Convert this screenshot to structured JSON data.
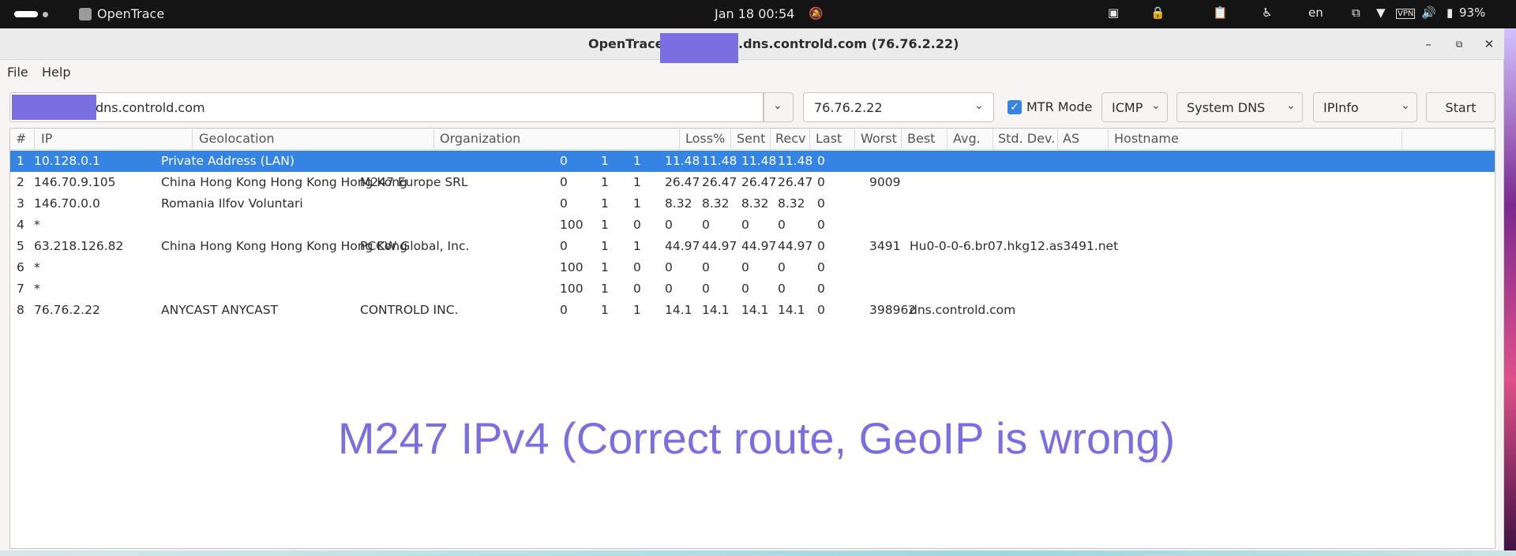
{
  "topbar": {
    "app_name": "OpenTrace",
    "datetime": "Jan 18  00:54",
    "lang": "en",
    "vpn": "VPN",
    "battery": "93%"
  },
  "window": {
    "title_prefix": "OpenTrace: ",
    "title_suffix": ".dns.controld.com (76.76.2.22)"
  },
  "menu": [
    "File",
    "Help"
  ],
  "toolbar": {
    "host_value": "dns.controld.com",
    "resolved_ip": "76.76.2.22",
    "mtr_mode_label": "MTR Mode",
    "mtr_mode_checked": true,
    "protocol": "ICMP",
    "dns": "System DNS",
    "geo_provider": "IPInfo",
    "start_label": "Start"
  },
  "table": {
    "headers": [
      "#",
      "IP",
      "Geolocation",
      "Organization",
      "Loss%",
      "Sent",
      "Recv",
      "Last",
      "Worst",
      "Best",
      "Avg.",
      "Std. Dev.",
      "AS",
      "Hostname"
    ],
    "rows": [
      [
        "1",
        "10.128.0.1",
        "Private Address (LAN)",
        "",
        "0",
        "1",
        "1",
        "11.48",
        "11.48",
        "11.48",
        "11.48",
        "0",
        "",
        ""
      ],
      [
        "2",
        "146.70.9.105",
        "China  Hong Kong Hong Kong Hong Kong",
        "M247 Europe SRL",
        "0",
        "1",
        "1",
        "26.47",
        "26.47",
        "26.47",
        "26.47",
        "0",
        "9009",
        ""
      ],
      [
        "3",
        "146.70.0.0",
        "Romania Ilfov Voluntari",
        "",
        "0",
        "1",
        "1",
        "8.32",
        "8.32",
        "8.32",
        "8.32",
        "0",
        "",
        ""
      ],
      [
        "4",
        "*",
        "",
        "",
        "100",
        "1",
        "0",
        "0",
        "0",
        "0",
        "0",
        "0",
        "",
        ""
      ],
      [
        "5",
        "63.218.126.82",
        "China  Hong Kong Hong Kong Hong Kong",
        "PCCW Global, Inc.",
        "0",
        "1",
        "1",
        "44.97",
        "44.97",
        "44.97",
        "44.97",
        "0",
        "3491",
        "Hu0-0-0-6.br07.hkg12.as3491.net"
      ],
      [
        "6",
        "*",
        "",
        "",
        "100",
        "1",
        "0",
        "0",
        "0",
        "0",
        "0",
        "0",
        "",
        ""
      ],
      [
        "7",
        "*",
        "",
        "",
        "100",
        "1",
        "0",
        "0",
        "0",
        "0",
        "0",
        "0",
        "",
        ""
      ],
      [
        "8",
        "76.76.2.22",
        "ANYCAST ANYCAST",
        "CONTROLD INC.",
        "0",
        "1",
        "1",
        "14.1",
        "14.1",
        "14.1",
        "14.1",
        "0",
        "398962",
        "dns.controld.com"
      ]
    ],
    "selected_row": 0
  },
  "annotation": "M247 IPv4 (Correct route, GeoIP is wrong)",
  "colors": {
    "selection": "#3584e4",
    "annotation": "#7b6ee0",
    "redaction": "#7b6ee0"
  }
}
